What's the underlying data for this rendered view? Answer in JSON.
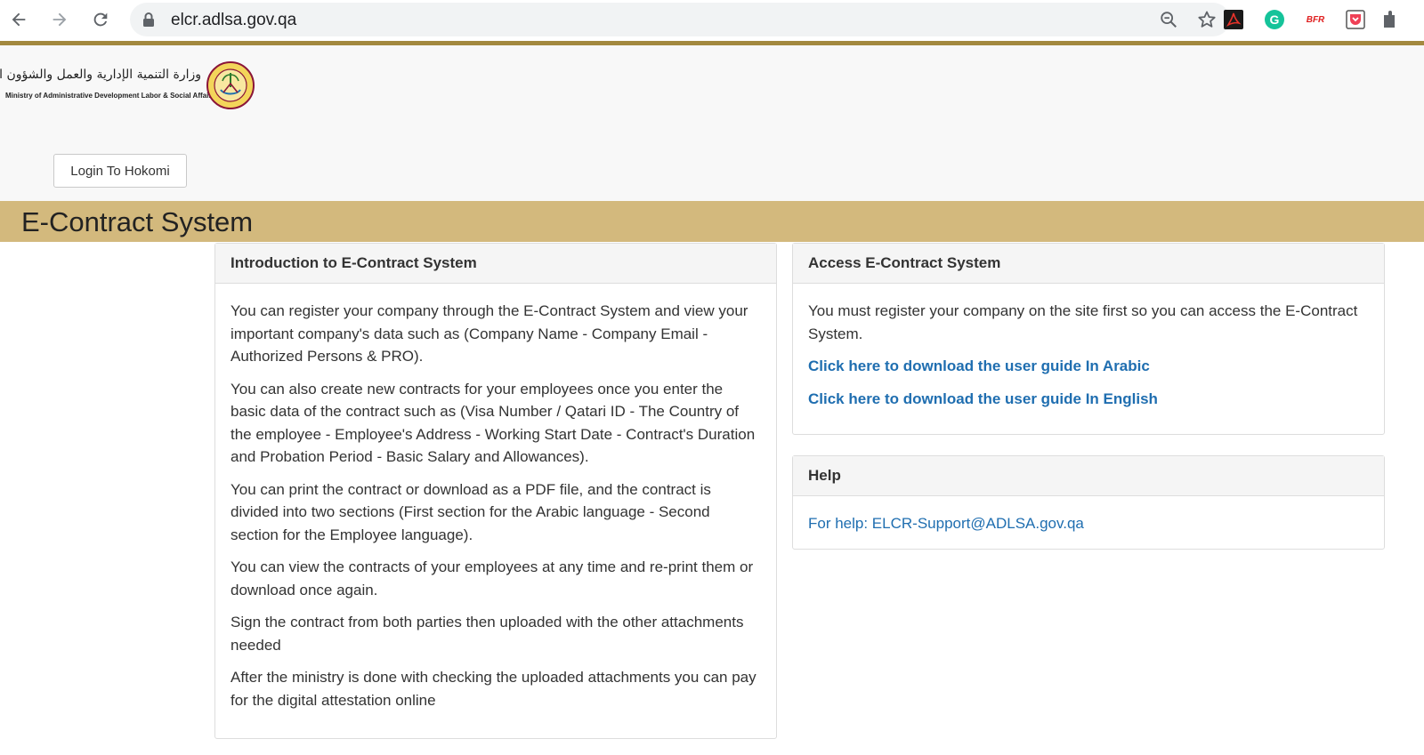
{
  "browser": {
    "url": "elcr.adlsa.gov.qa",
    "ext_bfr_label": "BFR",
    "ext_g_label": "G"
  },
  "header": {
    "logo_arabic": "وزارة التنمية الإدارية والعمل والشؤون الاجتماعية",
    "logo_english": "Ministry of Administrative Development Labor & Social Affairs",
    "login_label": "Login To Hokomi"
  },
  "page_title": "E-Contract System",
  "intro": {
    "heading": "Introduction to E-Contract System",
    "paragraphs": [
      "You can register your company through the E-Contract System and view your important company's data such as (Company Name - Company Email - Authorized Persons & PRO).",
      "You can also create new contracts for your employees once you enter the basic data of the contract such as (Visa Number / Qatari ID - The Country of the employee - Employee's Address - Working Start Date - Contract's Duration and Probation Period - Basic Salary and Allowances).",
      "You can print the contract or download as a PDF file, and the contract is divided into two sections (First section for the Arabic language - Second section for the Employee language).",
      "You can view the contracts of your employees at any time and re-print them or download once again.",
      "Sign the contract from both parties then uploaded with the other attachments needed",
      "After the ministry is done with checking the uploaded attachments you can pay for the digital attestation online"
    ]
  },
  "access": {
    "heading": "Access E-Contract System",
    "text": "You must register your company on the site first so you can access the E-Contract System.",
    "link_arabic": "Click here to download the user guide In Arabic",
    "link_english": "Click here to download the user guide In English"
  },
  "help": {
    "heading": "Help",
    "text": "For help: ELCR-Support@ADLSA.gov.qa"
  },
  "colors": {
    "accent_band": "#d3b97d",
    "gold_line": "#a3893f",
    "link": "#1f6eb0"
  }
}
